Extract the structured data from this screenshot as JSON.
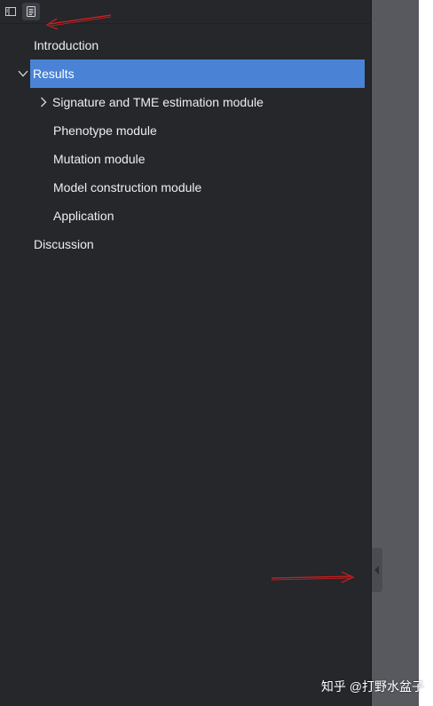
{
  "toolbar": {
    "buttons": [
      {
        "icon": "sidebar-toggle-icon",
        "active": false
      },
      {
        "icon": "outline-document-icon",
        "active": true
      }
    ]
  },
  "outline": {
    "items": [
      {
        "label": "Introduction",
        "level": 0,
        "expanded": null,
        "selected": false
      },
      {
        "label": "Results",
        "level": 0,
        "expanded": true,
        "selected": true
      },
      {
        "label": "Signature and TME estimation module",
        "level": 1,
        "expanded": false,
        "selected": false
      },
      {
        "label": "Phenotype module",
        "level": 1,
        "expanded": null,
        "selected": false
      },
      {
        "label": "Mutation module",
        "level": 1,
        "expanded": null,
        "selected": false
      },
      {
        "label": "Model construction module",
        "level": 1,
        "expanded": null,
        "selected": false
      },
      {
        "label": "Application",
        "level": 1,
        "expanded": null,
        "selected": false
      },
      {
        "label": "Discussion",
        "level": 0,
        "expanded": null,
        "selected": false
      }
    ]
  },
  "colors": {
    "sidebar_bg": "#25272b",
    "selection": "#4a83d6",
    "gutter": "#57595f",
    "annotation_arrow": "#d81e1e"
  },
  "watermark": "知乎 @打野水盆子"
}
